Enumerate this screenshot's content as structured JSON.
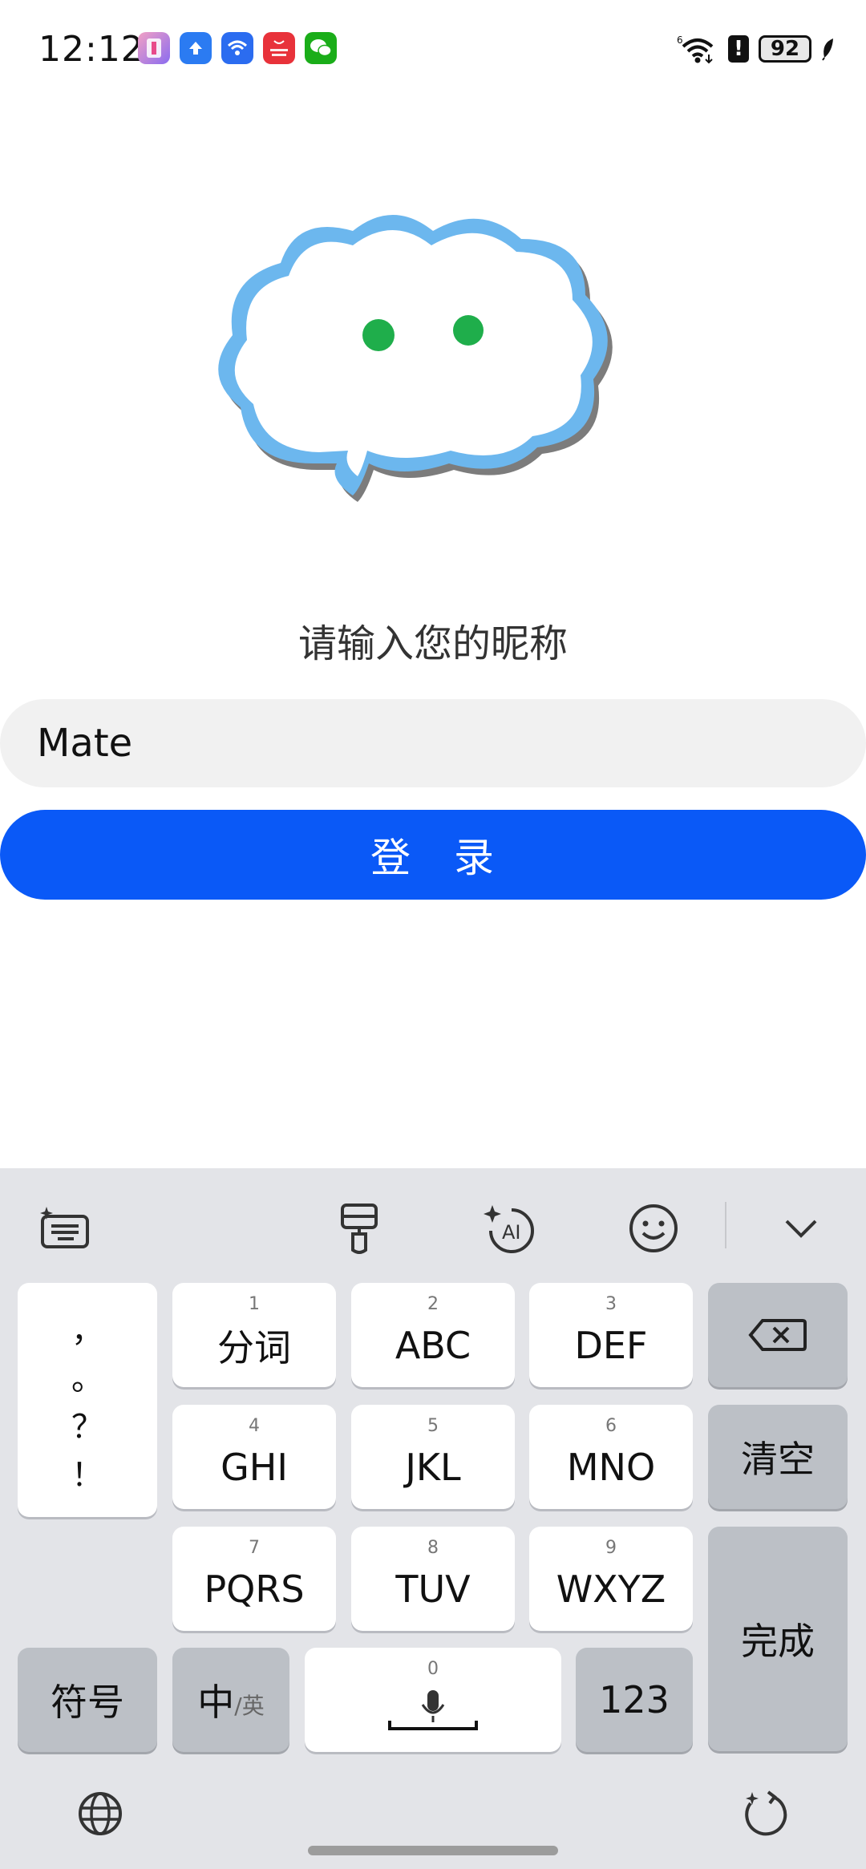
{
  "status_bar": {
    "time": "12:12",
    "signal_label": "6",
    "battery": "92",
    "alert_glyph": "!",
    "notification_icons": [
      {
        "name": "app-icon-pink",
        "color": "#e84a8a"
      },
      {
        "name": "app-icon-upload",
        "color": "#2b7bf2"
      },
      {
        "name": "app-icon-wifi",
        "color": "#2b6cf0"
      },
      {
        "name": "app-gallery-icon",
        "color": "#e8323a",
        "label": "App Gallery"
      },
      {
        "name": "wechat-icon",
        "color": "#1aad19"
      }
    ]
  },
  "login": {
    "prompt": "请输入您的昵称",
    "nickname_value": "Mate",
    "login_label": "登　录"
  },
  "keyboard": {
    "punct_keys": [
      "，",
      "。",
      "？",
      "！"
    ],
    "rows": [
      {
        "num": "1",
        "label": "分词"
      },
      {
        "num": "2",
        "label": "ABC"
      },
      {
        "num": "3",
        "label": "DEF"
      },
      {
        "num": "4",
        "label": "GHI"
      },
      {
        "num": "5",
        "label": "JKL"
      },
      {
        "num": "6",
        "label": "MNO"
      },
      {
        "num": "7",
        "label": "PQRS"
      },
      {
        "num": "8",
        "label": "TUV"
      },
      {
        "num": "9",
        "label": "WXYZ"
      }
    ],
    "clear_label": "清空",
    "done_label": "完成",
    "symbols_label": "符号",
    "lang_main": "中",
    "lang_alt": "/英",
    "space_num": "0",
    "numbers_label": "123"
  }
}
